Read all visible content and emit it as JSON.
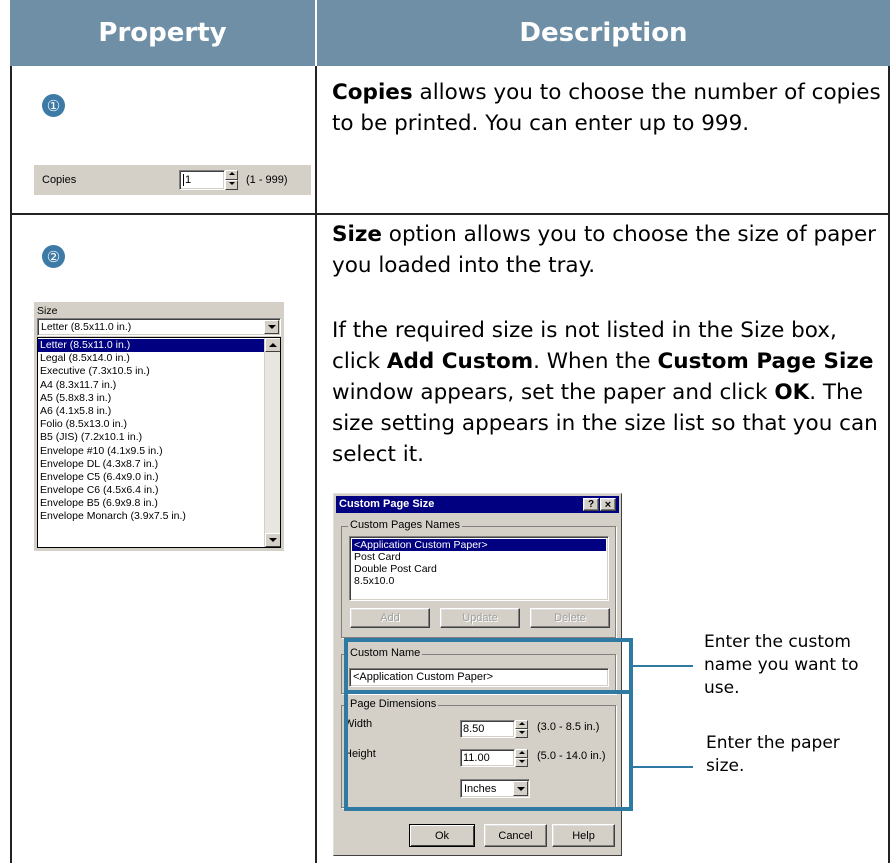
{
  "table": {
    "header_property": "Property",
    "header_description": "Description"
  },
  "row1": {
    "number": "①",
    "copies_label": "Copies",
    "copies_value": "1",
    "copies_range": "(1 - 999)",
    "desc_bold": "Copies",
    "desc_rest": " allows you to choose the number of copies to be printed. You can enter up to 999."
  },
  "row2": {
    "number": "②",
    "size_label": "Size",
    "size_selected": "Letter (8.5x11.0 in.)",
    "size_options": [
      "Letter (8.5x11.0 in.)",
      "Legal (8.5x14.0 in.)",
      "Executive (7.3x10.5 in.)",
      "A4 (8.3x11.7 in.)",
      "A5 (5.8x8.3 in.)",
      "A6 (4.1x5.8 in.)",
      "Folio (8.5x13.0 in.)",
      "B5 (JIS) (7.2x10.1 in.)",
      "Envelope #10 (4.1x9.5 in.)",
      "Envelope DL (4.3x8.7 in.)",
      "Envelope C5 (6.4x9.0 in.)",
      "Envelope C6 (4.5x6.4 in.)",
      "Envelope B5 (6.9x9.8 in.)",
      "Envelope Monarch (3.9x7.5 in.)"
    ],
    "para1_bold": "Size",
    "para1_rest": " option allows you to choose the size of paper you loaded into the tray.",
    "para2_a": "If the required size is not listed in the Size box, click ",
    "para2_b": "Add Custom",
    "para2_c": ". When the ",
    "para2_d": "Custom Page Size",
    "para2_e": " window appears, set the paper and click ",
    "para2_f": "OK",
    "para2_g": ". The size setting appears in the size list so that you can select it."
  },
  "dialog": {
    "title": "Custom Page Size",
    "title_help": "?",
    "title_close": "×",
    "names_group": "Custom Pages Names",
    "names": [
      "<Application Custom Paper>",
      "Post Card",
      "Double Post Card",
      "8.5x10.0"
    ],
    "add_label": "Add",
    "update_label": "Update",
    "delete_label": "Delete",
    "custom_name_group": "Custom Name",
    "custom_name_value": "<Application Custom Paper>",
    "dims_group": "Page Dimensions",
    "width_label": "Width",
    "width_value": "8.50",
    "width_range": "(3.0 - 8.5 in.)",
    "height_label": "Height",
    "height_value": "11.00",
    "height_range": "(5.0 - 14.0 in.)",
    "units_value": "Inches",
    "ok_label": "Ok",
    "cancel_label": "Cancel",
    "help_label": "Help"
  },
  "callouts": {
    "name_text": "Enter the custom name you want to use.",
    "size_text": "Enter the paper size."
  },
  "colors": {
    "header_bg": "#6f8fa7",
    "accent": "#2f7aa2",
    "selection": "#000080",
    "dialog_title": "#000080"
  }
}
